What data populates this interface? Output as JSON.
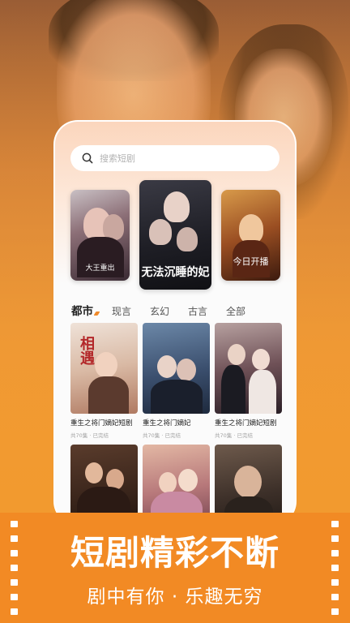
{
  "search": {
    "placeholder": "搜索短剧"
  },
  "banners": [
    {
      "title": "大王重出"
    },
    {
      "title": "无法沉睡的妃"
    },
    {
      "title": "今日开播"
    }
  ],
  "tabs": [
    "都市",
    "现言",
    "玄幻",
    "古言",
    "全部"
  ],
  "dramas": [
    {
      "title": "重生之将门嫡妃短剧",
      "meta": "共70集 · 已完结",
      "poster_text": "相遇"
    },
    {
      "title": "重生之将门嫡妃",
      "meta": "共70集 · 已完结",
      "poster_text": ""
    },
    {
      "title": "重生之将门嫡妃短剧",
      "meta": "共70集 · 已完结",
      "poster_text": ""
    },
    {
      "title": "",
      "meta": "",
      "poster_text": ""
    },
    {
      "title": "",
      "meta": "",
      "poster_text": ""
    },
    {
      "title": "",
      "meta": "",
      "poster_text": ""
    }
  ],
  "promo": {
    "headline": "短剧精彩不断",
    "subline": "剧中有你 · 乐趣无穷"
  },
  "colors": {
    "accent": "#f28a24",
    "tab_indicator": "#f08a2a"
  }
}
